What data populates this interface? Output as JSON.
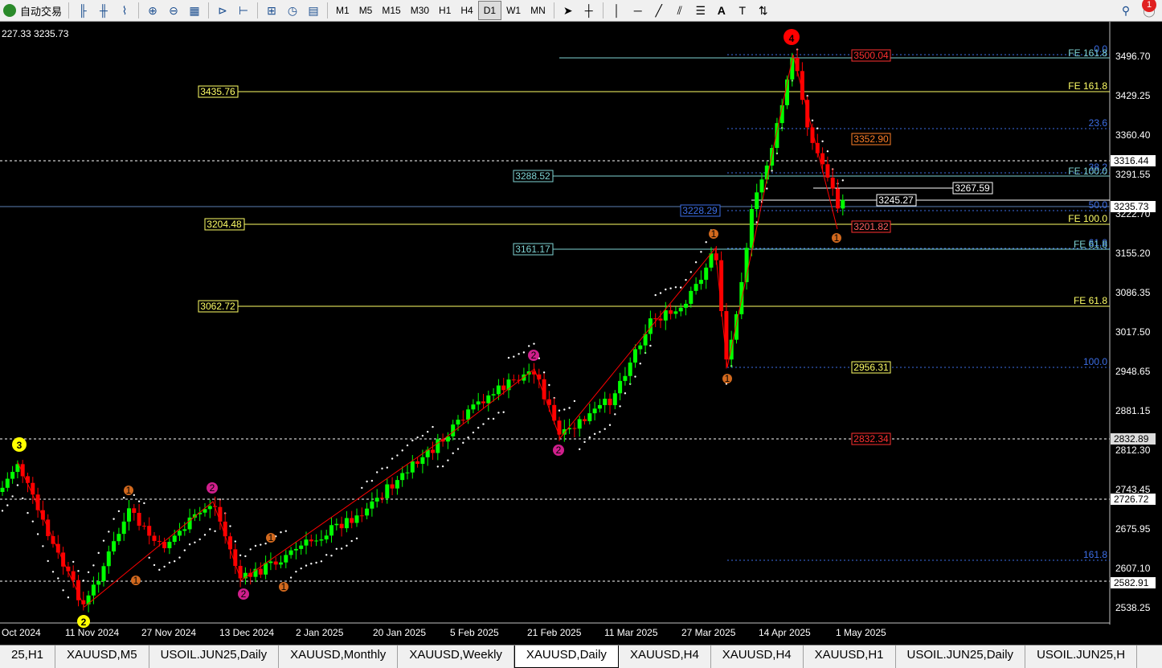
{
  "toolbar": {
    "auto_trade_label": "自动交易",
    "timeframes": [
      "M1",
      "M5",
      "M15",
      "M30",
      "H1",
      "H4",
      "D1",
      "W1",
      "MN"
    ],
    "active_timeframe": "D1",
    "notification_count": "1"
  },
  "chart": {
    "ohlc_header": "227.33 3235.73",
    "price_ticks": [
      "3496.70",
      "3429.25",
      "3360.40",
      "3291.55",
      "3222.70",
      "3155.20",
      "3086.35",
      "3017.50",
      "2948.65",
      "2881.15",
      "2812.30",
      "2743.45",
      "2675.95",
      "2607.10",
      "2538.25"
    ],
    "date_ticks": [
      "Oct 2024",
      "11 Nov 2024",
      "27 Nov 2024",
      "13 Dec 2024",
      "2 Jan 2025",
      "20 Jan 2025",
      "5 Feb 2025",
      "21 Feb 2025",
      "11 Mar 2025",
      "27 Mar 2025",
      "14 Apr 2025",
      "1 May 2025"
    ],
    "axis_boxes": [
      "3316.44",
      "3235.73",
      "2832.89",
      "2726.72",
      "2582.91"
    ],
    "level_labels": [
      "3435.76",
      "3288.52",
      "3228.29",
      "3204.48",
      "3161.17",
      "3062.72"
    ],
    "right_labels": [
      "3500.04",
      "3352.90",
      "3245.27",
      "3267.59",
      "3201.82",
      "2956.31",
      "2832.34"
    ],
    "fib_labels": [
      "0.0",
      "FE 161.8",
      "FE 161.8",
      "23.6",
      "38.2",
      "FE 100.0",
      "50.0",
      "FE 100.0",
      "61.8",
      "FE 61.8",
      "FE 61.8",
      "100.0",
      "161.8"
    ],
    "wave_labels": [
      "4",
      "3",
      "2",
      "1",
      "2",
      "1",
      "2",
      "1",
      "2",
      "1",
      "2",
      "1",
      "1",
      "1"
    ]
  },
  "colors": {
    "bull": "#00ff00",
    "bear": "#ff0000",
    "yellow_line": "#ffff66",
    "cyan_line": "#7fd4d4",
    "blue_fib": "#3c6ee6",
    "wave_line": "#ff0000"
  },
  "tabs": [
    "25,H1",
    "XAUUSD,M5",
    "USOIL.JUN25,Daily",
    "XAUUSD,Monthly",
    "XAUUSD,Weekly",
    "XAUUSD,Daily",
    "XAUUSD,H4",
    "XAUUSD,H4",
    "XAUUSD,H1",
    "USOIL.JUN25,Daily",
    "USOIL.JUN25,H"
  ],
  "active_tab": "XAUUSD,Daily"
}
